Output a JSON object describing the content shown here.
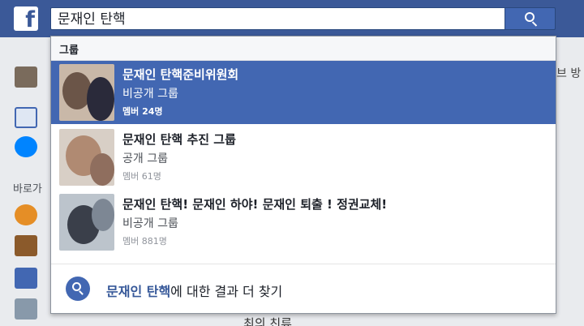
{
  "topbar": {
    "logo_letter": "f",
    "search_value": "문재인 탄핵"
  },
  "dropdown": {
    "section_header": "그룹",
    "results": [
      {
        "title": "문재인 탄핵준비위원회",
        "subtitle": "비공개 그룹",
        "meta": "멤버 24명",
        "active": true
      },
      {
        "title": "문재인 탄핵 추진 그룹",
        "subtitle": "공개 그룹",
        "meta": "멤버 61명",
        "active": false
      },
      {
        "title": "문재인 탄핵! 문재인 하야! 문재인 퇴출 ! 정권교체!",
        "subtitle": "비공개 그룹",
        "meta": "멤버 881명",
        "active": false
      }
    ],
    "more_query": "문재인 탄핵",
    "more_suffix": "에 대한 결과 더 찾기"
  },
  "sidebar": {
    "shortcuts_label": "바로가"
  },
  "background": {
    "right_edge_text": "브 방",
    "bottom_text": "최의 친류"
  },
  "colors": {
    "topbar": "#3b5998",
    "active_row": "#4267b2",
    "link": "#365899"
  }
}
